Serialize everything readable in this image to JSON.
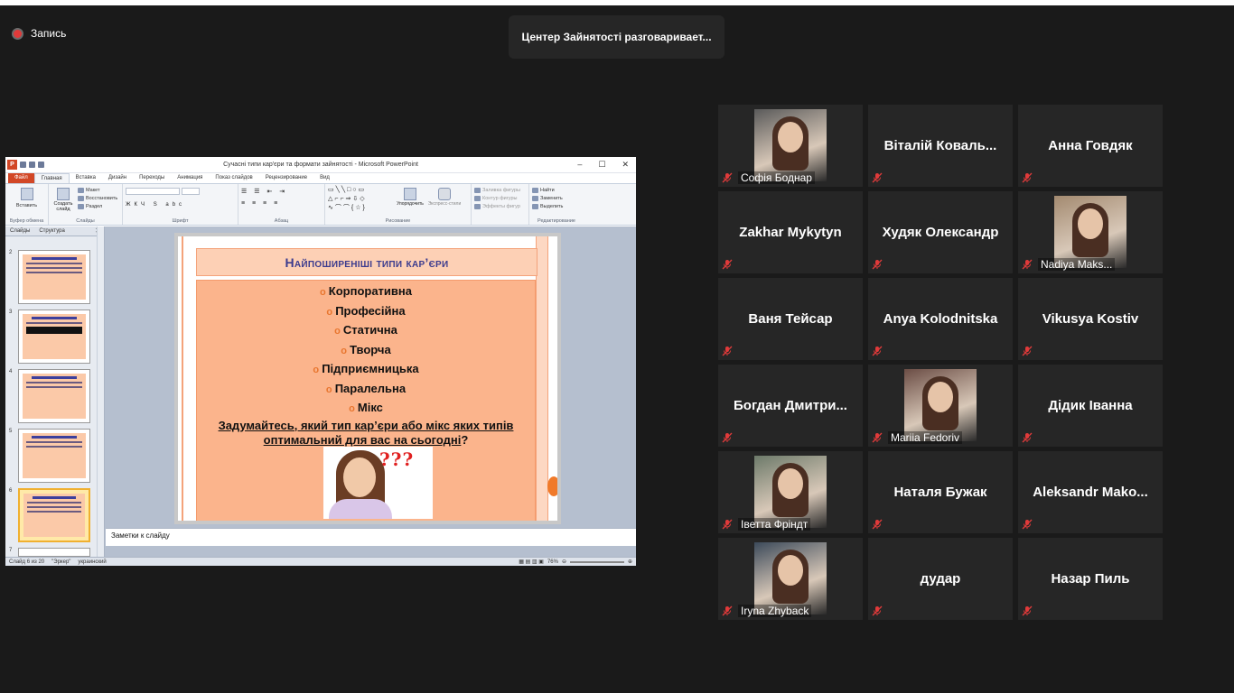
{
  "recording": {
    "label": "Запись"
  },
  "speaker": {
    "text": "Центер Зайнятості разговаривает..."
  },
  "ppt": {
    "window_title": "Сучасні типи кар'єри та формати зайнятості - Microsoft PowerPoint",
    "tabs": [
      "Файл",
      "Главная",
      "Вставка",
      "Дизайн",
      "Переходы",
      "Анимация",
      "Показ слайдов",
      "Рецензирование",
      "Вид"
    ],
    "ribbon": {
      "paste": "Вставить",
      "clipboard": "Буфер обмена",
      "create_slide": "Создать слайд",
      "layout": "Макет",
      "restore": "Восстановить",
      "section": "Раздел",
      "slides_group": "Слайды",
      "font_group": "Шрифт",
      "paragraph_group": "Абзац",
      "arrange": "Упорядочить",
      "express_styles": "Экспресс-стили",
      "fill": "Заливка фигуры",
      "outline": "Контур фигуры",
      "effects": "Эффекты фигур",
      "drawing_group": "Рисование",
      "find": "Найти",
      "replace": "Заменить",
      "select": "Выделить",
      "editing_group": "Редактирование"
    },
    "pane_tabs": {
      "slides": "Слайды",
      "outline": "Структура"
    },
    "thumbnail_numbers": [
      "2",
      "3",
      "4",
      "5",
      "6",
      "7"
    ],
    "slide": {
      "title": "Найпоширеніші типи кар’єри",
      "bullets": [
        "Корпоративна",
        "Професійна",
        "Статична",
        "Творча",
        "Підприємницька",
        "Паралельна",
        "Мікс"
      ],
      "question_line1": "Задумайтесь, який тип кар’єри або мікс яких типів",
      "question_line2": "оптимальний для вас на сьогодні",
      "question_mark": "?",
      "pic_text": "???"
    },
    "notes_placeholder": "Заметки к слайду",
    "status": {
      "slide": "Слайд 6 из 20",
      "theme": "\"Эркер\"",
      "language": "украинский",
      "zoom": "76%"
    }
  },
  "participants": [
    {
      "name": "Софія Боднар",
      "has_video": true
    },
    {
      "name": "Віталій  Коваль...",
      "has_video": false
    },
    {
      "name": "Анна Говдяк",
      "has_video": false
    },
    {
      "name": "Zakhar Mykytyn",
      "has_video": false
    },
    {
      "name": "Худяк Олександр",
      "has_video": false
    },
    {
      "name": "Nadiya Maks...",
      "has_video": true
    },
    {
      "name": "Ваня Тейсар",
      "has_video": false
    },
    {
      "name": "Anya Kolodnitska",
      "has_video": false
    },
    {
      "name": "Vikusya Kostiv",
      "has_video": false
    },
    {
      "name": "Богдан  Дмитри...",
      "has_video": false
    },
    {
      "name": "Mariia Fedoriv",
      "has_video": true
    },
    {
      "name": "Дідик Іванна",
      "has_video": false
    },
    {
      "name": "Іветта Фріндт",
      "has_video": true
    },
    {
      "name": "Наталя Бужак",
      "has_video": false
    },
    {
      "name": "Aleksandr  Mako...",
      "has_video": false
    },
    {
      "name": "Iryna Zhyback",
      "has_video": true
    },
    {
      "name": "дудар",
      "has_video": false
    },
    {
      "name": "Назар Пиль",
      "has_video": false
    }
  ],
  "icons": {
    "mic_muted": "mic-muted-icon",
    "record": "record-icon"
  },
  "colors": {
    "background": "#1a1a1a",
    "tile": "#262626",
    "muted_mic": "#e03a3a",
    "slide_title": "#3b3b8e",
    "slide_body": "#fbb48c"
  }
}
